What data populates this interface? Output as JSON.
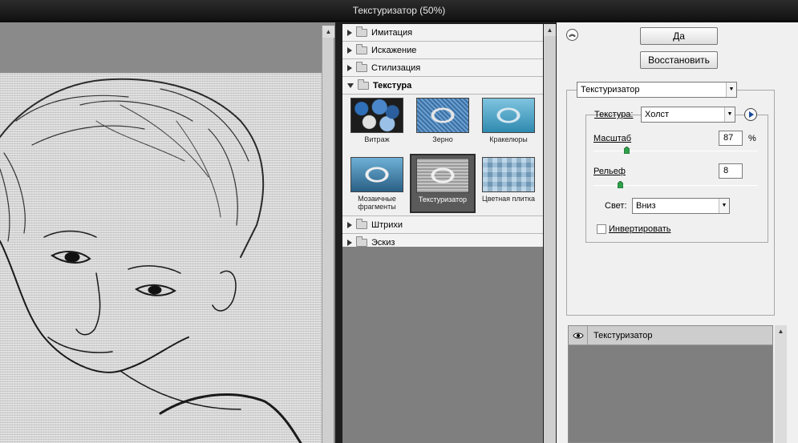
{
  "window": {
    "title": "Текстуризатор (50%)"
  },
  "gallery": {
    "categories_top": [
      {
        "label": "Имитация",
        "open": false
      },
      {
        "label": "Искажение",
        "open": false
      },
      {
        "label": "Стилизация",
        "open": false
      },
      {
        "label": "Текстура",
        "open": true
      }
    ],
    "thumbs": [
      {
        "label": "Витраж",
        "icon": "stained-glass-thumbnail",
        "selected": false
      },
      {
        "label": "Зерно",
        "icon": "grain-thumbnail",
        "selected": false
      },
      {
        "label": "Кракелюры",
        "icon": "craquelure-thumbnail",
        "selected": false
      },
      {
        "label": "Мозаичные фрагменты",
        "icon": "mosaic-tiles-thumbnail",
        "selected": false
      },
      {
        "label": "Текстуризатор",
        "icon": "texturizer-thumbnail",
        "selected": true
      },
      {
        "label": "Цветная плитка",
        "icon": "patchwork-thumbnail",
        "selected": false
      }
    ],
    "categories_bottom": [
      {
        "label": "Штрихи",
        "open": false
      },
      {
        "label": "Эскиз",
        "open": false
      }
    ]
  },
  "settings": {
    "ok_label": "Да",
    "reset_label": "Восстановить",
    "filter_select": "Текстуризатор",
    "texture_label": "Текстура:",
    "texture_value": "Холст",
    "scale_label": "Масштаб",
    "scale_value": "87",
    "scale_unit": "%",
    "scale_fraction": 0.2,
    "relief_label": "Рельеф",
    "relief_value": "8",
    "relief_fraction": 0.16,
    "light_label": "Свет:",
    "light_value": "Вниз",
    "invert_label": "Инвертировать",
    "invert_checked": false
  },
  "layers": [
    {
      "name": "Текстуризатор",
      "visible": true
    }
  ]
}
